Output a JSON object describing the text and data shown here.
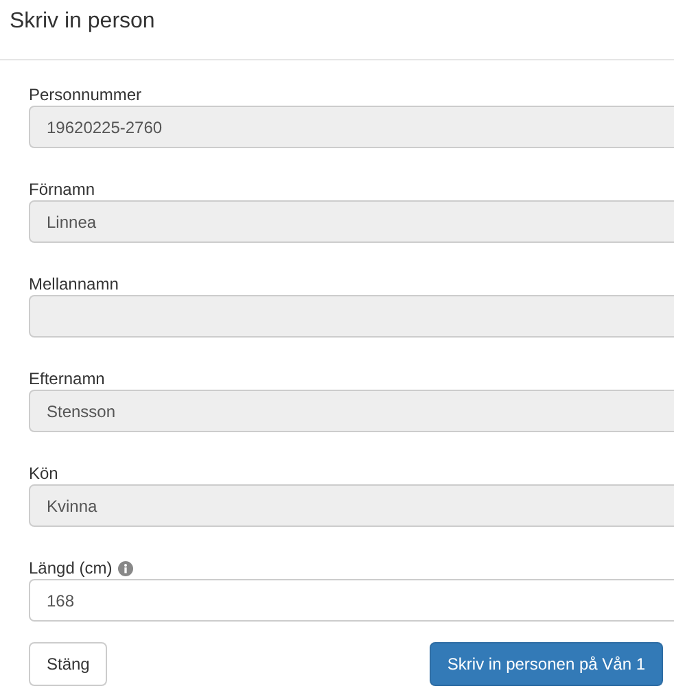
{
  "window": {
    "title": "Skriv in person"
  },
  "fields": [
    {
      "label": "Personnummer",
      "value": "19620225-2760",
      "disabled": true,
      "info": false
    },
    {
      "label": "Förnamn",
      "value": "Linnea",
      "disabled": true,
      "info": false
    },
    {
      "label": "Mellannamn",
      "disabled": true,
      "info": false
    },
    {
      "label": "Efternamn",
      "value": "Stensson",
      "disabled": true,
      "info": false
    },
    {
      "label": "Kön",
      "value": "Kvinna",
      "disabled": true,
      "info": false
    },
    {
      "label": "Längd (cm)",
      "value": "168",
      "disabled": false,
      "info": true
    }
  ],
  "buttons": [
    {
      "label": "Stäng",
      "kind": "default"
    },
    {
      "label": "Skriv in personen på Vån 1",
      "kind": "primary"
    }
  ]
}
